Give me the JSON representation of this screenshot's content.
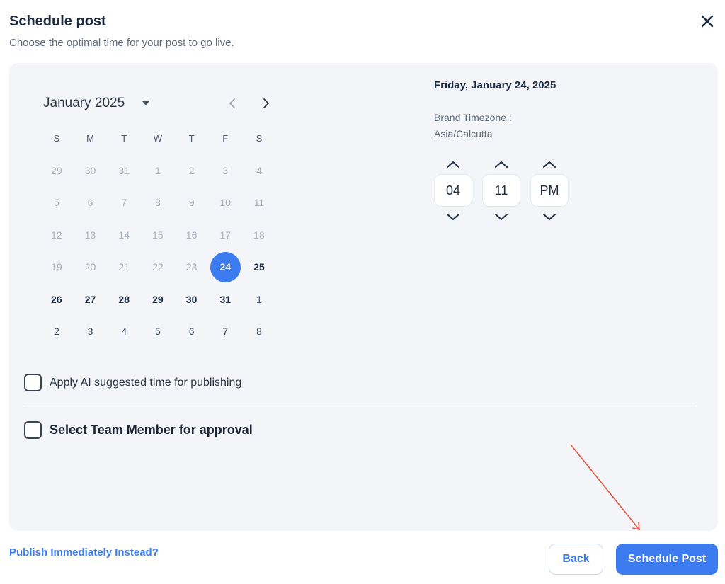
{
  "header": {
    "title": "Schedule post",
    "subtitle": "Choose the optimal time for your post to go live.",
    "close_icon": "close-icon"
  },
  "calendar": {
    "month_label": "January 2025",
    "weekdays": [
      "S",
      "M",
      "T",
      "W",
      "T",
      "F",
      "S"
    ],
    "weeks": [
      [
        "29",
        "30",
        "31",
        "1",
        "2",
        "3",
        "4"
      ],
      [
        "5",
        "6",
        "7",
        "8",
        "9",
        "10",
        "11"
      ],
      [
        "12",
        "13",
        "14",
        "15",
        "16",
        "17",
        "18"
      ],
      [
        "19",
        "20",
        "21",
        "22",
        "23",
        "24",
        "25"
      ],
      [
        "26",
        "27",
        "28",
        "29",
        "30",
        "31",
        "1"
      ],
      [
        "2",
        "3",
        "4",
        "5",
        "6",
        "7",
        "8"
      ]
    ],
    "selected_day": "24"
  },
  "schedule": {
    "date_heading": "Friday, January 24, 2025",
    "timezone_label": "Brand Timezone :",
    "timezone_value": "Asia/Calcutta",
    "hour": "04",
    "minute": "11",
    "period": "PM"
  },
  "options": {
    "ai_label": "Apply AI suggested time for publishing",
    "ai_checked": false,
    "team_label": "Select Team Member for approval",
    "team_checked": false
  },
  "footer": {
    "publish_link": "Publish Immediately Instead?",
    "back_label": "Back",
    "schedule_label": "Schedule Post"
  },
  "colors": {
    "accent": "#3d7bf0",
    "panel_bg": "#f3f5f8",
    "annotation_arrow": "#e5533d"
  }
}
